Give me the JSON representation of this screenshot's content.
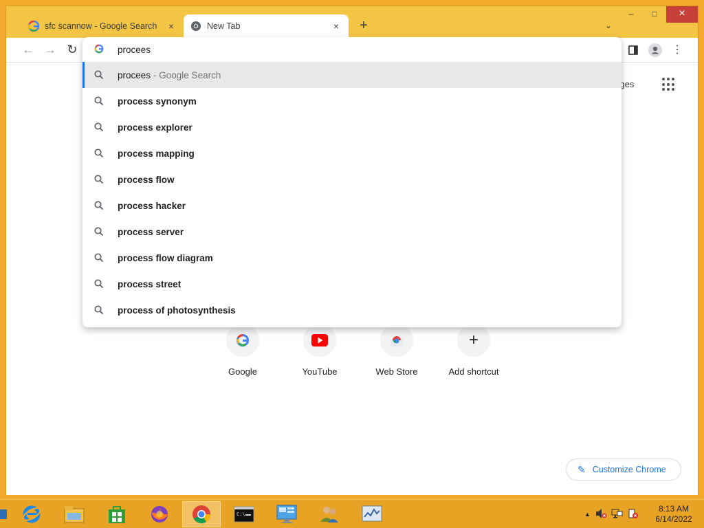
{
  "tabs": [
    {
      "title": "sfc scannow - Google Search",
      "favicon": "google-g-icon",
      "close": "×"
    },
    {
      "title": "New Tab",
      "favicon": "chrome-icon",
      "close": "×"
    }
  ],
  "newtab_symbol": "+",
  "tab_search_symbol": "⌄",
  "window_controls": {
    "minimize": "–",
    "maximize": "□",
    "close": "×"
  },
  "toolbar": {
    "back": "←",
    "forward": "→",
    "reload": "↻",
    "sidepanel_icon": "sidepanel-icon",
    "profile_icon": "profile-icon",
    "menu": "⋮"
  },
  "omnibox": {
    "input_value": "procees ",
    "g_logo": "G",
    "selected": {
      "query": "procees",
      "suffix": "- Google Search"
    },
    "suggestions": [
      "process synonym",
      "process explorer",
      "process mapping",
      "process flow",
      "process hacker",
      "process server",
      "process flow diagram",
      "process street",
      "process of photosynthesis"
    ]
  },
  "page": {
    "images_link": "nages",
    "shortcuts": [
      {
        "label": "Google",
        "icon": "google-g-icon"
      },
      {
        "label": "YouTube",
        "icon": "youtube-icon"
      },
      {
        "label": "Web Store",
        "icon": "chrome-webstore-icon"
      },
      {
        "label": "Add shortcut",
        "icon": "plus-icon"
      }
    ],
    "add_symbol": "+",
    "customize_label": "Customize Chrome"
  },
  "taskbar": {
    "apps": [
      "ie-icon",
      "file-explorer-icon",
      "store-icon",
      "firefox-icon",
      "chrome-icon",
      "cmd-icon",
      "control-panel-icon",
      "users-icon",
      "perfmon-icon"
    ],
    "clock_time": "8:13 AM",
    "clock_date": "6/14/2022",
    "tray_arrow": "▲"
  },
  "colors": {
    "accent": "#1a73e8",
    "desktop": "#f4a92c",
    "titlebar": "#f4c545",
    "close_red": "#c7413a"
  }
}
